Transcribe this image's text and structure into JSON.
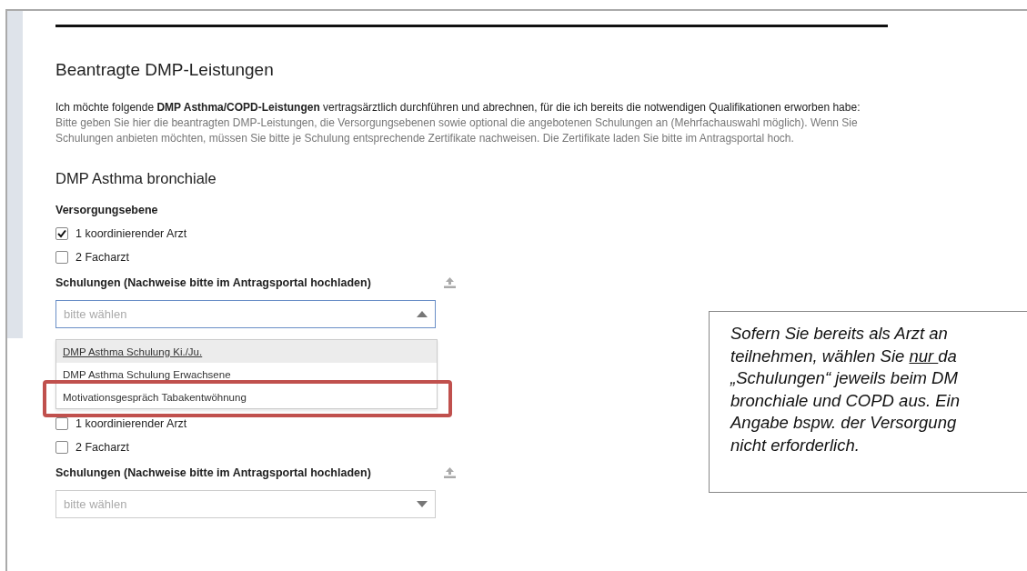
{
  "heading": "Beantragte DMP-Leistungen",
  "intro": "Ich möchte folgende **DMP Asthma/COPD-Leistungen** vertragsärztlich durchführen und abrechnen, für die ich bereits die notwendigen Qualifikationen erworben habe:",
  "hint": "Bitte geben Sie hier die beantragten DMP-Leistungen, die Versorgungsebenen sowie optional die angebotenen Schulungen an (Mehrfachauswahl möglich). Wenn Sie Schulungen anbieten möchten, müssen Sie bitte je Schulung entsprechende Zertifikate nachweisen. Die Zertifikate laden Sie bitte im Antragsportal hoch.",
  "sections": [
    {
      "title": "DMP Asthma bronchiale",
      "level_label": "Versorgungsebene",
      "levels": [
        {
          "label": "1 koordinierender Arzt",
          "checked": true
        },
        {
          "label": "2 Facharzt",
          "checked": false
        }
      ],
      "training_label": "Schulungen (Nachweise bitte im Antragsportal hochladen)",
      "select": {
        "placeholder": "bitte wählen",
        "expanded": true,
        "options": [
          {
            "label": "DMP Asthma Schulung Ki./Ju.",
            "highlighted": true
          },
          {
            "label": "DMP Asthma Schulung Erwachsene",
            "highlighted": false
          },
          {
            "label": "Motivationsgespräch Tabakentwöhnung",
            "highlighted": false
          }
        ]
      }
    },
    {
      "levels": [
        {
          "label": "1 koordinierender Arzt",
          "checked": false
        },
        {
          "label": "2 Facharzt",
          "checked": false
        }
      ],
      "training_label": "Schulungen (Nachweise bitte im Antragsportal hochladen)",
      "select": {
        "placeholder": "bitte wählen",
        "expanded": false
      }
    }
  ],
  "callout": {
    "lines": [
      [
        {
          "text": "Sofern Sie bereits als Arzt an",
          "underline": false
        }
      ],
      [
        {
          "text": "teilnehmen, wählen Sie ",
          "underline": false
        },
        {
          "text": "nur ",
          "underline": true
        },
        {
          "text": "da",
          "underline": false
        }
      ],
      [
        {
          "text": "„Schulungen“ jeweils beim DM",
          "underline": false
        }
      ],
      [
        {
          "text": "bronchiale und COPD aus. Ein",
          "underline": false
        }
      ],
      [
        {
          "text": "Angabe bspw. der Versorgung",
          "underline": false
        }
      ],
      [
        {
          "text": "nicht erforderlich.",
          "underline": false
        }
      ]
    ]
  }
}
